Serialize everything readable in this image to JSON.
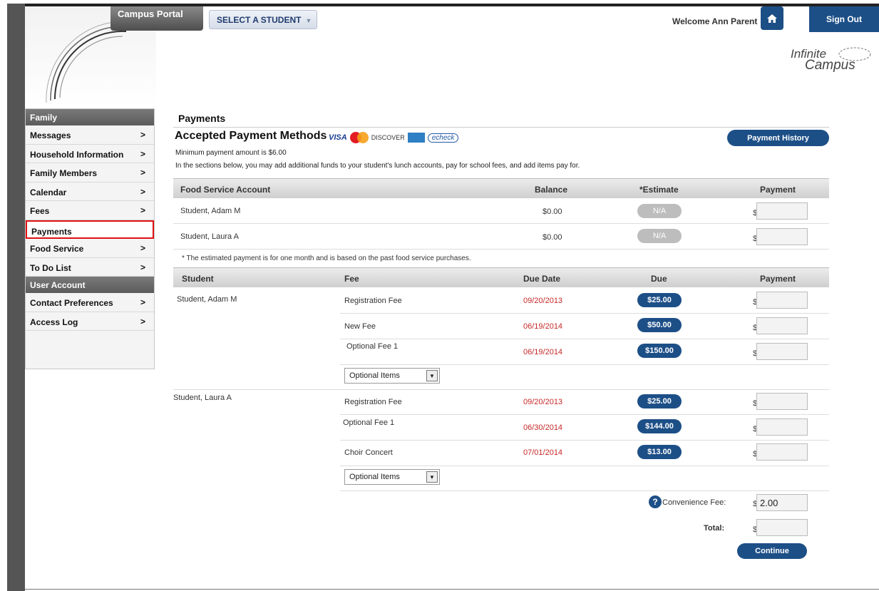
{
  "header": {
    "portal_label": "Campus Portal",
    "select_student_label": "SELECT A STUDENT",
    "welcome_text": "Welcome Ann Parent",
    "sign_out_label": "Sign Out",
    "logo_line1": "Infinite",
    "logo_line2": "Campus"
  },
  "sidebar": {
    "family_heading": "Family",
    "family_items": [
      {
        "label": "Messages",
        "chevron": ">"
      },
      {
        "label": "Household Information",
        "chevron": ">"
      },
      {
        "label": "Family Members",
        "chevron": ">"
      },
      {
        "label": "Calendar",
        "chevron": ">"
      },
      {
        "label": "Fees",
        "chevron": ">"
      },
      {
        "label": "Payments",
        "chevron": ""
      },
      {
        "label": "Food Service",
        "chevron": ">"
      },
      {
        "label": "To Do List",
        "chevron": ">"
      }
    ],
    "user_heading": "User Account",
    "user_items": [
      {
        "label": "Contact Preferences",
        "chevron": ">"
      },
      {
        "label": "Access Log",
        "chevron": ">"
      }
    ]
  },
  "main": {
    "title": "Payments",
    "accepted_methods": "Accepted Payment Methods",
    "card_visa": "VISA",
    "card_discover": "DISCOVER",
    "card_echeck": "echeck",
    "payment_history_label": "Payment History",
    "min_payment": "Minimum payment amount is $6.00",
    "instructions": "In the sections below, you may add additional funds to your student's lunch accounts, pay for school fees, and add items pay for.",
    "food_table": {
      "headers": [
        "Food Service Account",
        "Balance",
        "*Estimate",
        "Payment"
      ],
      "rows": [
        {
          "name": "Student, Adam M",
          "balance": "$0.00",
          "estimate": "N/A",
          "currency": "$"
        },
        {
          "name": "Student, Laura A",
          "balance": "$0.00",
          "estimate": "N/A",
          "currency": "$"
        }
      ],
      "footnote": "* The estimated payment is for one month and is based on the past food service purchases."
    },
    "fee_table": {
      "headers": [
        "Student",
        "Fee",
        "Due Date",
        "Due",
        "Payment"
      ],
      "students": [
        {
          "name": "Student, Adam M",
          "fees": [
            {
              "fee": "Registration Fee",
              "date": "09/20/2013",
              "due": "$25.00",
              "currency": "$"
            },
            {
              "fee": "New Fee",
              "date": "06/19/2014",
              "due": "$50.00",
              "currency": "$"
            },
            {
              "fee": "Optional Fee 1",
              "date": "06/19/2014",
              "due": "$150.00",
              "currency": "$"
            }
          ],
          "optional_label": "Optional Items"
        },
        {
          "name": "Student, Laura A",
          "fees": [
            {
              "fee": "Registration Fee",
              "date": "09/20/2013",
              "due": "$25.00",
              "currency": "$"
            },
            {
              "fee": "Optional Fee 1",
              "date": "06/30/2014",
              "due": "$144.00",
              "currency": "$"
            },
            {
              "fee": "Choir Concert",
              "date": "07/01/2014",
              "due": "$13.00",
              "currency": "$"
            }
          ],
          "optional_label": "Optional Items"
        }
      ]
    },
    "convenience_label": "Convenience Fee:",
    "convenience_currency": "$",
    "convenience_value": "2.00",
    "total_label": "Total:",
    "total_currency": "$",
    "help_glyph": "?",
    "continue_label": "Continue"
  }
}
